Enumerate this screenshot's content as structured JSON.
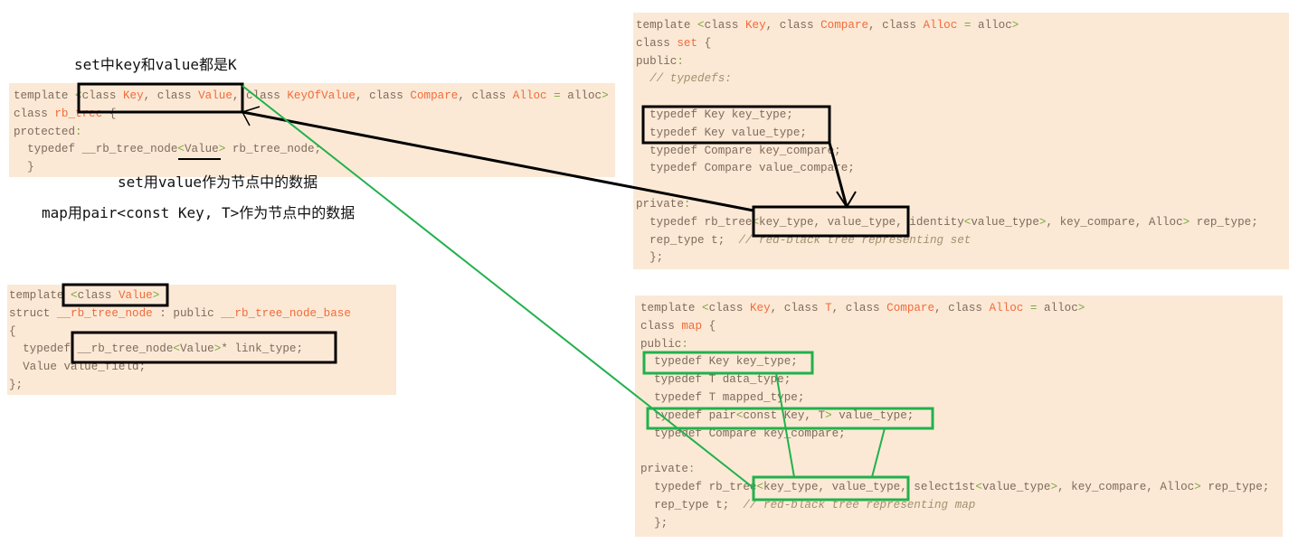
{
  "notes": {
    "set_key_value": "set中key和value都是K",
    "set_node_data": "set用value作为节点中的数据",
    "map_node_data": "map用pair<const Key, T>作为节点中的数据"
  },
  "colors": {
    "background": "#fbe9d6",
    "text": "#7f6b5b",
    "identifier": "#f26b3a",
    "bracket": "#7ca83e",
    "comment": "#a4906f",
    "set_annotation": "#000000",
    "map_annotation": "#22b14c"
  },
  "code_blocks": {
    "rb_tree": [
      [
        [
          "template ",
          "k"
        ],
        [
          "<",
          "p"
        ],
        [
          "class ",
          "k"
        ],
        [
          "Key",
          "o"
        ],
        [
          ", class ",
          "k"
        ],
        [
          "Value",
          "o"
        ],
        [
          ", class ",
          "k"
        ],
        [
          "KeyOfValue",
          "o"
        ],
        [
          ", class ",
          "k"
        ],
        [
          "Compare",
          "o"
        ],
        [
          ", class ",
          "k"
        ],
        [
          "Alloc",
          "o"
        ],
        [
          " ",
          "k"
        ],
        [
          "=",
          "p"
        ],
        [
          " alloc",
          "k"
        ],
        [
          ">",
          "p"
        ]
      ],
      [
        [
          "class ",
          "k"
        ],
        [
          "rb_tree",
          "o"
        ],
        [
          " {",
          "k"
        ]
      ],
      [
        [
          "protected",
          "k"
        ],
        [
          ":",
          "p"
        ]
      ],
      [
        [
          "  typedef __rb_tree_node",
          "k"
        ],
        [
          "<",
          "p"
        ],
        [
          "Value",
          "k"
        ],
        [
          ">",
          "p"
        ],
        [
          " rb_tree_node;",
          "k"
        ]
      ],
      [
        [
          "  }",
          "k"
        ]
      ]
    ],
    "rb_tree_node": [
      [
        [
          "template ",
          "k"
        ],
        [
          "<",
          "p"
        ],
        [
          "class ",
          "k"
        ],
        [
          "Value",
          "o"
        ],
        [
          ">",
          "p"
        ]
      ],
      [
        [
          "struct ",
          "k"
        ],
        [
          "__rb_tree_node",
          "o"
        ],
        [
          " : public ",
          "k"
        ],
        [
          "__rb_tree_node_base",
          "o"
        ]
      ],
      [
        [
          "{",
          "k"
        ]
      ],
      [
        [
          "  typedef __rb_tree_node",
          "k"
        ],
        [
          "<",
          "p"
        ],
        [
          "Value",
          "k"
        ],
        [
          ">",
          "p"
        ],
        [
          "* link_type;",
          "k"
        ]
      ],
      [
        [
          "  Value value_field;",
          "k"
        ]
      ],
      [
        [
          "};",
          "k"
        ]
      ]
    ],
    "set": [
      [
        [
          "template ",
          "k"
        ],
        [
          "<",
          "p"
        ],
        [
          "class ",
          "k"
        ],
        [
          "Key",
          "o"
        ],
        [
          ", class ",
          "k"
        ],
        [
          "Compare",
          "o"
        ],
        [
          ", class ",
          "k"
        ],
        [
          "Alloc",
          "o"
        ],
        [
          " ",
          "k"
        ],
        [
          "=",
          "p"
        ],
        [
          " alloc",
          "k"
        ],
        [
          ">",
          "p"
        ]
      ],
      [
        [
          "class ",
          "k"
        ],
        [
          "set",
          "o"
        ],
        [
          " {",
          "k"
        ]
      ],
      [
        [
          "public",
          "k"
        ],
        [
          ":",
          "p"
        ]
      ],
      [
        [
          "  // typedefs:",
          "c"
        ]
      ],
      [
        [
          "",
          "k"
        ]
      ],
      [
        [
          "  typedef Key key_type;",
          "k"
        ]
      ],
      [
        [
          "  typedef Key value_type;",
          "k"
        ]
      ],
      [
        [
          "  typedef Compare key_compare;",
          "k"
        ]
      ],
      [
        [
          "  typedef Compare value_compare;",
          "k"
        ]
      ],
      [
        [
          "",
          "k"
        ]
      ],
      [
        [
          "private",
          "k"
        ],
        [
          ":",
          "p"
        ]
      ],
      [
        [
          "  typedef rb_tree",
          "k"
        ],
        [
          "<",
          "p"
        ],
        [
          "key_type, value_type, identity",
          "k"
        ],
        [
          "<",
          "p"
        ],
        [
          "value_type",
          "k"
        ],
        [
          ">",
          "p"
        ],
        [
          ", key_compare, Alloc",
          "k"
        ],
        [
          ">",
          "p"
        ],
        [
          " rep_type;",
          "k"
        ]
      ],
      [
        [
          "  rep_type t;  ",
          "k"
        ],
        [
          "// red-black tree representing set",
          "c"
        ]
      ],
      [
        [
          "  };",
          "k"
        ]
      ]
    ],
    "map": [
      [
        [
          "template ",
          "k"
        ],
        [
          "<",
          "p"
        ],
        [
          "class ",
          "k"
        ],
        [
          "Key",
          "o"
        ],
        [
          ", class ",
          "k"
        ],
        [
          "T",
          "o"
        ],
        [
          ", class ",
          "k"
        ],
        [
          "Compare",
          "o"
        ],
        [
          ", class ",
          "k"
        ],
        [
          "Alloc",
          "o"
        ],
        [
          " ",
          "k"
        ],
        [
          "=",
          "p"
        ],
        [
          " alloc",
          "k"
        ],
        [
          ">",
          "p"
        ]
      ],
      [
        [
          "class ",
          "k"
        ],
        [
          "map",
          "o"
        ],
        [
          " {",
          "k"
        ]
      ],
      [
        [
          "public",
          "k"
        ],
        [
          ":",
          "p"
        ]
      ],
      [
        [
          "  typedef Key key_type;",
          "k"
        ]
      ],
      [
        [
          "  typedef T data_type;",
          "k"
        ]
      ],
      [
        [
          "  typedef T mapped_type;",
          "k"
        ]
      ],
      [
        [
          "  typedef pair",
          "k"
        ],
        [
          "<",
          "p"
        ],
        [
          "const Key, T",
          "k"
        ],
        [
          ">",
          "p"
        ],
        [
          " value_type;",
          "k"
        ]
      ],
      [
        [
          "  typedef Compare key_compare;",
          "k"
        ]
      ],
      [
        [
          "",
          "k"
        ]
      ],
      [
        [
          "private",
          "k"
        ],
        [
          ":",
          "p"
        ]
      ],
      [
        [
          "  typedef rb_tree",
          "k"
        ],
        [
          "<",
          "p"
        ],
        [
          "key_type, value_type, select1st",
          "k"
        ],
        [
          "<",
          "p"
        ],
        [
          "value_type",
          "k"
        ],
        [
          ">",
          "p"
        ],
        [
          ", key_compare, Alloc",
          "k"
        ],
        [
          ">",
          "p"
        ],
        [
          " rep_type;",
          "k"
        ]
      ],
      [
        [
          "  rep_type t;  ",
          "k"
        ],
        [
          "// red-black tree representing map",
          "c"
        ]
      ],
      [
        [
          "  };",
          "k"
        ]
      ]
    ]
  }
}
